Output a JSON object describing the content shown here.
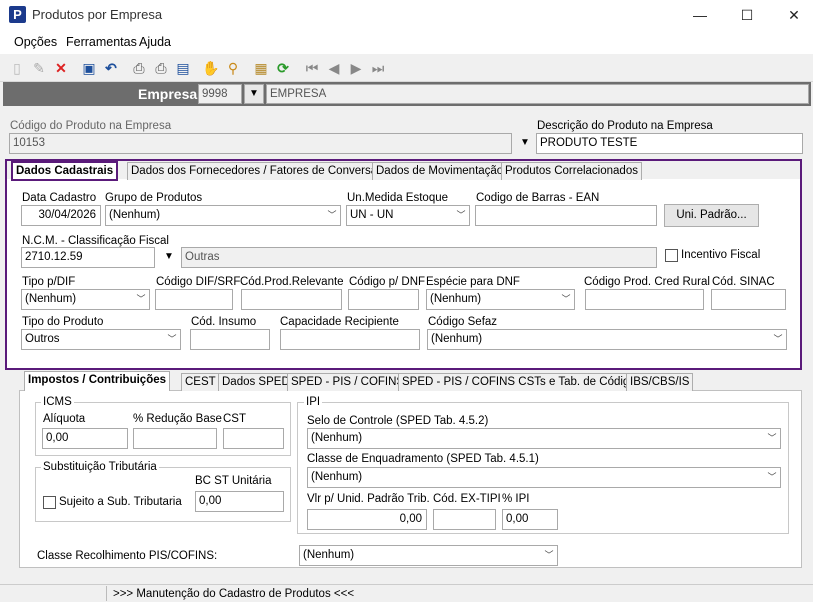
{
  "window": {
    "title": "Produtos por Empresa",
    "app_icon": "P",
    "minimize": "—",
    "maximize": "☐",
    "close": "✕"
  },
  "menu": [
    "Opções",
    "Ferramentas",
    "Ajuda"
  ],
  "empresa": {
    "label": "Empresa",
    "code": "9998",
    "name": "EMPRESA"
  },
  "codigo": {
    "label": "Código do Produto na Empresa",
    "value": "10153"
  },
  "descricao": {
    "label": "Descrição do Produto na Empresa",
    "value": "PRODUTO TESTE"
  },
  "tabs": [
    "Dados Cadastrais",
    "Dados dos Fornecedores / Fatores de Conversão",
    "Dados de Movimentação",
    "Produtos Correlacionados"
  ],
  "dados": {
    "data_cadastro": {
      "label": "Data Cadastro",
      "value": "30/04/2026"
    },
    "grupo": {
      "label": "Grupo de Produtos",
      "value": "(Nenhum)"
    },
    "unidade": {
      "label": "Un.Medida Estoque",
      "value": "UN - UN"
    },
    "ean": {
      "label": "Codigo de Barras - EAN",
      "value": ""
    },
    "uni_padrao": "Uni. Padrão...",
    "ncm": {
      "label": "N.C.M. -  Classificação Fiscal",
      "code": "2710.12.59",
      "desc": "Outras"
    },
    "incentivo": "Incentivo Fiscal",
    "tipo_dif": {
      "label": "Tipo p/DIF",
      "value": "(Nenhum)"
    },
    "cod_dif": {
      "label": "Código DIF/SRF",
      "value": ""
    },
    "cod_relevante": {
      "label": "Cód.Prod.Relevante",
      "value": ""
    },
    "cod_dnf": {
      "label": "Código p/ DNF",
      "value": ""
    },
    "especie_dnf": {
      "label": "Espécie para DNF",
      "value": "(Nenhum)"
    },
    "cod_cred_rural": {
      "label": "Código Prod. Cred Rural",
      "value": ""
    },
    "cod_sinac": {
      "label": "Cód. SINAC",
      "value": ""
    },
    "tipo_produto": {
      "label": "Tipo do Produto",
      "value": "Outros"
    },
    "cod_insumo": {
      "label": "Cód. Insumo",
      "value": ""
    },
    "capacidade": {
      "label": "Capacidade Recipiente",
      "value": ""
    },
    "sefaz": {
      "label": "Código Sefaz",
      "value": "(Nenhum)"
    }
  },
  "tabs2": [
    "Impostos / Contribuições",
    "CEST",
    "Dados SPED",
    "SPED - PIS / COFINS",
    "SPED - PIS / COFINS CSTs e Tab. de Códigos",
    "IBS/CBS/IS"
  ],
  "impostos": {
    "icms": {
      "title": "ICMS",
      "aliquota_label": "Alíquota",
      "aliquota": "0,00",
      "reducao_label": "% Redução Base",
      "reducao": "",
      "cst_label": "CST",
      "cst": ""
    },
    "st": {
      "title": "Substituição Tributária",
      "bc_label": "BC ST Unitária",
      "bc": "0,00",
      "sujeito": "Sujeito a Sub. Tributaria"
    },
    "ipi": {
      "title": "IPI",
      "selo_label": "Selo de Controle (SPED Tab. 4.5.2)",
      "selo": "(Nenhum)",
      "classe_label": "Classe de Enquadramento (SPED Tab. 4.5.1)",
      "classe": "(Nenhum)",
      "vlr_label": "Vlr p/ Unid. Padrão Trib.",
      "vlr": "0,00",
      "extipi_label": "Cód. EX-TIPI",
      "extipi": "",
      "pct_label": "% IPI",
      "pct": "0,00"
    },
    "classe_pis_label": "Classe Recolhimento PIS/COFINS:",
    "classe_pis": "(Nenhum)"
  },
  "status": {
    "message": ">>> Manutenção do Cadastro de Produtos <<<"
  }
}
